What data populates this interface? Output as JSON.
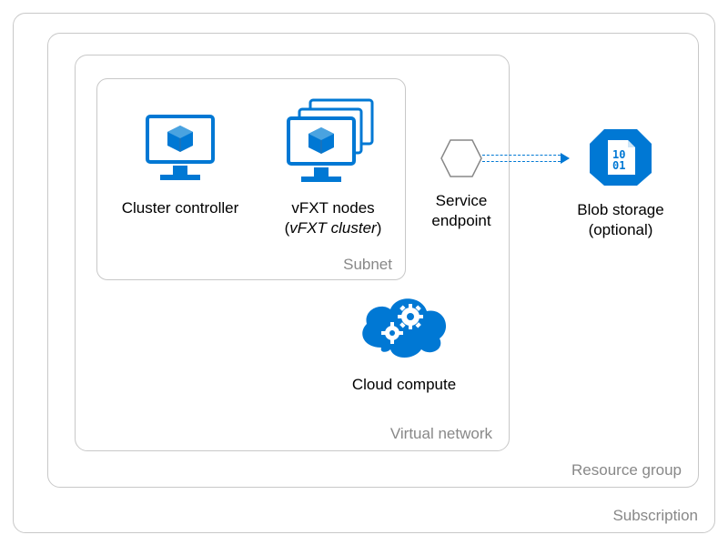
{
  "boxes": {
    "subscription": "Subscription",
    "resource_group": "Resource group",
    "vnet": "Virtual network",
    "subnet": "Subnet"
  },
  "items": {
    "cluster_controller": {
      "label": "Cluster controller"
    },
    "vfxt_nodes": {
      "label_line1": "vFXT nodes",
      "label_line2_prefix": "(",
      "label_line2_italic": "vFXT cluster",
      "label_line2_suffix": ")"
    },
    "service_endpoint": {
      "label_line1": "Service",
      "label_line2": "endpoint"
    },
    "blob_storage": {
      "label_line1": "Blob storage",
      "label_line2": "(optional)"
    },
    "cloud_compute": {
      "label": "Cloud compute"
    }
  },
  "colors": {
    "azure_blue": "#0078d4",
    "light_blue": "#50a9e8",
    "gray": "#888888"
  }
}
